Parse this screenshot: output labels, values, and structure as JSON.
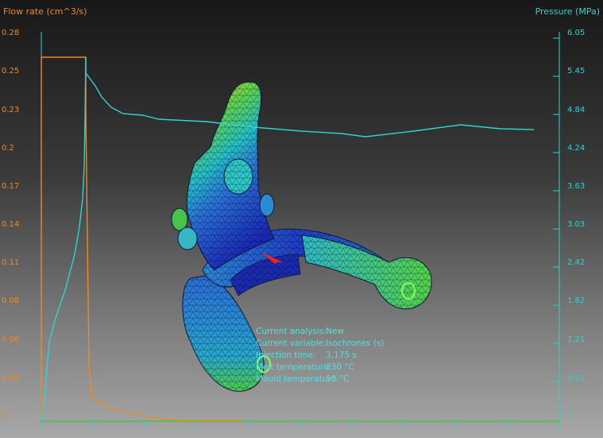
{
  "left_axis": {
    "title": "Flow rate (cm^3/s)",
    "ticks": [
      "0.28",
      "0.25",
      "0.23",
      "0.2",
      "0.17",
      "0.14",
      "0.11",
      "0.08",
      "0.06",
      "0.03",
      "0"
    ],
    "color": "#f08a1c"
  },
  "right_axis": {
    "title": "Pressure (MPa)",
    "ticks": [
      "6.05",
      "5.45",
      "4.84",
      "4.24",
      "3.63",
      "3.03",
      "2.42",
      "1.82",
      "1.21",
      "0.61",
      "0"
    ],
    "color": "#2ed3d3"
  },
  "info": {
    "analysis_label": "Current analysis:",
    "analysis_value": "New",
    "variable_label": "Current variable:",
    "variable_value": "Isochrones (s)",
    "injection_label": "Injection time:",
    "injection_value": "3.175 s",
    "melt_label": "Melt temperature:",
    "melt_value": "230 °C",
    "mould_label": "Mould temperature:",
    "mould_value": "50 °C"
  },
  "colors": {
    "flow_curve": "#f08a1c",
    "pressure_curve": "#2ed3d3",
    "baseline": "#2ecc40"
  }
}
